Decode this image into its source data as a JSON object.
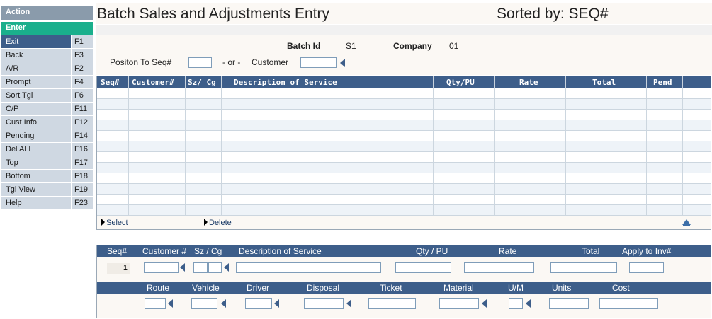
{
  "sidebar": {
    "action_label": "Action",
    "enter_label": "Enter",
    "items": [
      {
        "label": "Exit",
        "key": "F1"
      },
      {
        "label": "Back",
        "key": "F3"
      },
      {
        "label": "A/R",
        "key": "F2"
      },
      {
        "label": "Prompt",
        "key": "F4"
      },
      {
        "label": "Sort Tgl",
        "key": "F6"
      },
      {
        "label": "C/P",
        "key": "F11"
      },
      {
        "label": "Cust Info",
        "key": "F12"
      },
      {
        "label": "Pending",
        "key": "F14"
      },
      {
        "label": "Del ALL",
        "key": "F16"
      },
      {
        "label": "Top",
        "key": "F17"
      },
      {
        "label": "Bottom",
        "key": "F18"
      },
      {
        "label": "Tgl View",
        "key": "F19"
      },
      {
        "label": "Help",
        "key": "F23"
      }
    ]
  },
  "header": {
    "title": "Batch Sales and Adjustments Entry",
    "sorted_by": "Sorted by: SEQ#"
  },
  "info": {
    "batch_id_label": "Batch Id",
    "batch_id_value": "S1",
    "company_label": "Company",
    "company_value": "01",
    "position_label": "Positon To Seq#",
    "or_label": "- or -",
    "customer_label": "Customer"
  },
  "grid": {
    "columns": [
      "Seq#",
      "Customer#",
      "Sz/ Cg",
      "Description of Service",
      "Qty/PU",
      "Rate",
      "Total",
      "Pend"
    ],
    "select_label": "Select",
    "delete_label": "Delete"
  },
  "entry": {
    "headers": [
      "Seq#",
      "Customer #",
      "Sz / Cg",
      "Description of Service",
      "Qty / PU",
      "Rate",
      "Total",
      "Apply to Inv#"
    ],
    "seq_value": "1",
    "headers2": [
      "Route",
      "Vehicle",
      "Driver",
      "Disposal",
      "Ticket",
      "Material",
      "U/M",
      "Units",
      "Cost"
    ]
  },
  "colors": {
    "header_bar": "#3d5e8a",
    "enter_green": "#1aaf8c",
    "action_gray": "#8a9bab",
    "menu_item_bg": "#cfd8e2"
  }
}
